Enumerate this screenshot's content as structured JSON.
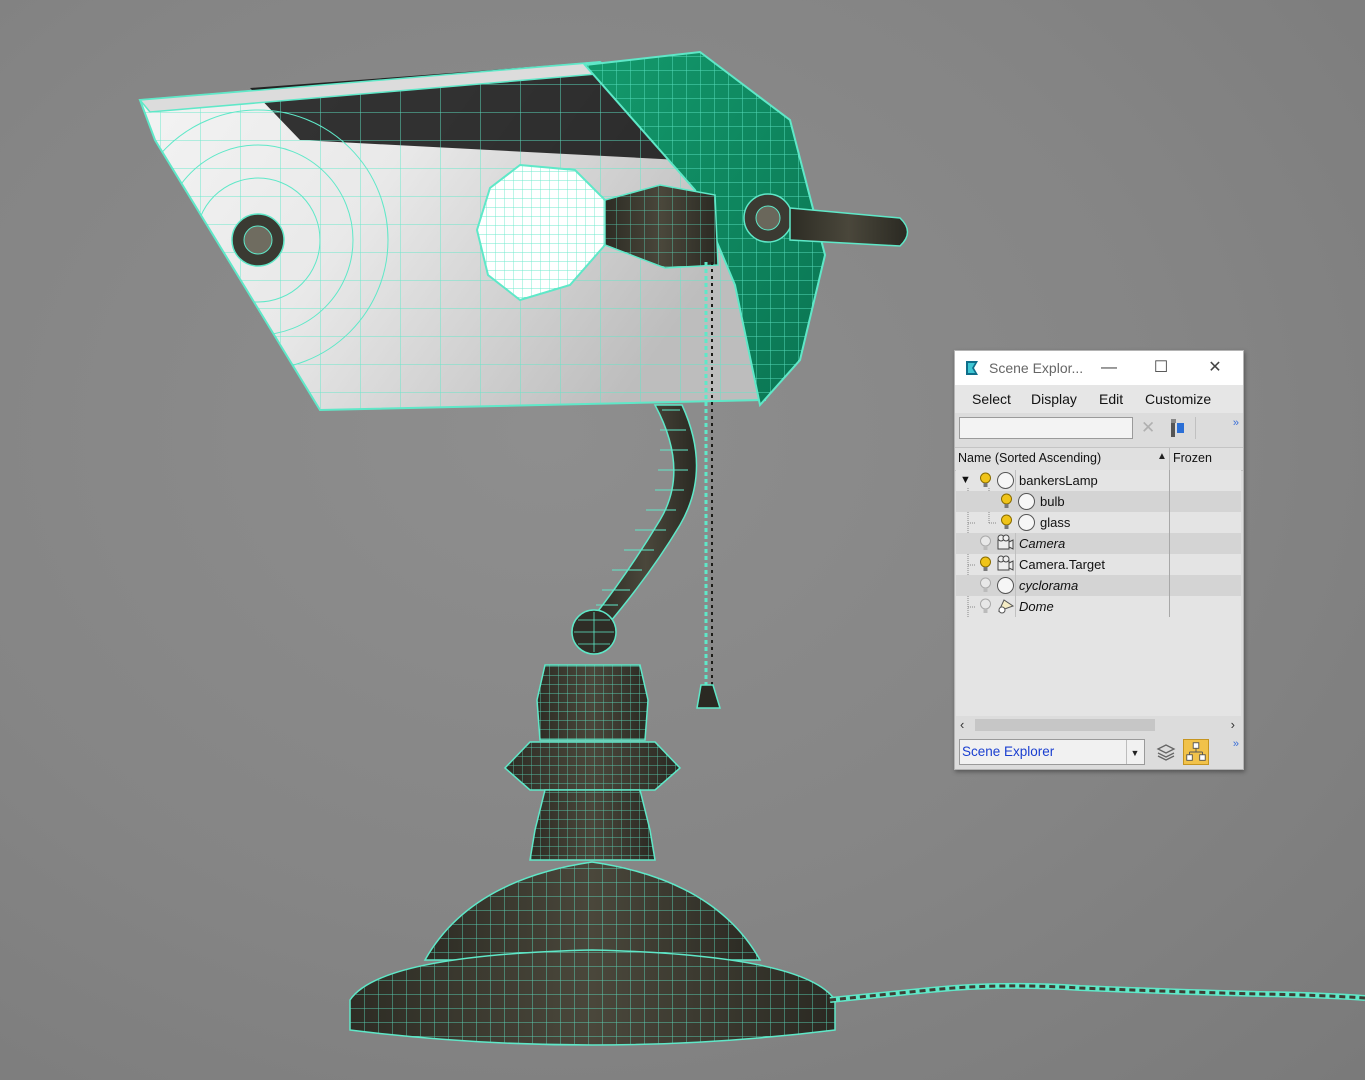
{
  "scene_explorer": {
    "title": "Scene Explor...",
    "window_buttons": {
      "minimize": "—",
      "maximize": "☐",
      "close": "✕"
    },
    "menu": [
      "Select",
      "Display",
      "Edit",
      "Customize"
    ],
    "search": {
      "value": "",
      "placeholder": ""
    },
    "toolbar_more": "»",
    "columns": {
      "name": "Name (Sorted Ascending)",
      "frozen": "Frozen"
    },
    "items": [
      {
        "label": "bankersLamp",
        "italic": false,
        "icon": "geometry-icon",
        "light": "on"
      },
      {
        "label": "bulb",
        "italic": false,
        "icon": "geometry-icon",
        "light": "on"
      },
      {
        "label": "glass",
        "italic": false,
        "icon": "geometry-icon",
        "light": "on"
      },
      {
        "label": "Camera",
        "italic": true,
        "icon": "camera-icon",
        "light": "off"
      },
      {
        "label": "Camera.Target",
        "italic": false,
        "icon": "camera-icon",
        "light": "on"
      },
      {
        "label": "cyclorama",
        "italic": true,
        "icon": "geometry-icon",
        "light": "off"
      },
      {
        "label": "Dome",
        "italic": true,
        "icon": "dome-light-icon",
        "light": "off"
      }
    ],
    "explorer_select": {
      "value": "Scene Explorer"
    },
    "bottom_more": "»"
  },
  "colors": {
    "viewport_bg": "#858585",
    "wireframe": "#5fe8c8",
    "shade_green": "#0f8a62",
    "accent_blue": "#1a3fd0",
    "active_button": "#f1c24a"
  }
}
